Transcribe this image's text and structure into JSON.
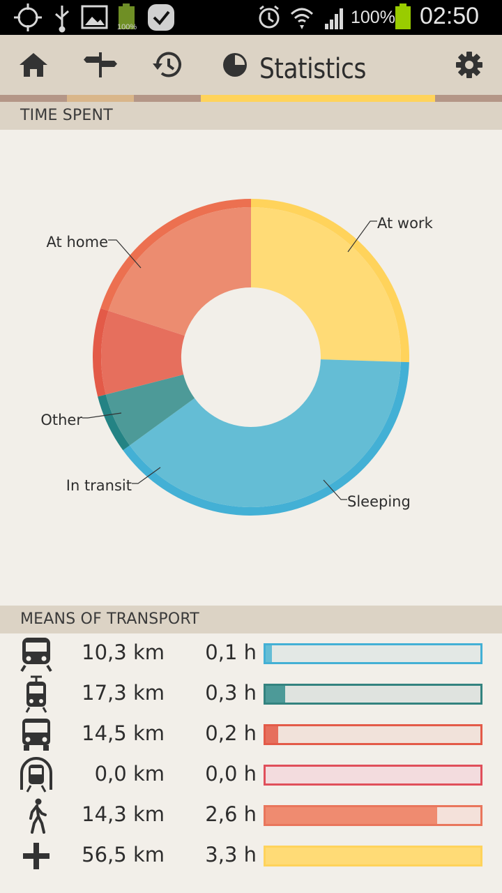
{
  "status_bar": {
    "battery_small_pct": "100%",
    "battery_pct": "100%",
    "time": "02:50",
    "icons": [
      "gps-icon",
      "usb-icon",
      "gallery-icon",
      "battery-small-icon",
      "check-icon",
      "alarm-icon",
      "wifi-icon",
      "signal-icon",
      "battery-icon"
    ]
  },
  "nav": {
    "title": "Statistics",
    "icons": [
      "home-icon",
      "signpost-icon",
      "history-icon",
      "statistics-pie-icon",
      "settings-gear-icon"
    ],
    "tab_colors": [
      "#b49687",
      "#d9b68a",
      "#b49687",
      "#ffd35b",
      "#b49687"
    ]
  },
  "time_spent": {
    "header": "TIME SPENT",
    "chart_data": {
      "type": "pie",
      "variant": "donut",
      "labels": [
        "At work",
        "Sleeping",
        "In transit",
        "Other",
        "At home"
      ],
      "values": [
        25.5,
        39.5,
        6.0,
        9.0,
        20.0
      ],
      "unit": "% of time (estimated)",
      "colors": [
        "#ffdb76",
        "#64bdd5",
        "#4d9a98",
        "#e66f5d",
        "#ec8c70"
      ],
      "rim_colors": [
        "#ffd35b",
        "#43b0d5",
        "#248384",
        "#e35a48",
        "#ec7050"
      ]
    }
  },
  "transport": {
    "header": "MEANS OF TRANSPORT",
    "rows": [
      {
        "icon": "train-icon",
        "distance": "10,3 km",
        "time": "0,1 h",
        "fraction": 0.03,
        "border": "#43b0d5",
        "fill": "#64bdd5",
        "track": "#e3e8e5"
      },
      {
        "icon": "tram-icon",
        "distance": "17,3 km",
        "time": "0,3 h",
        "fraction": 0.09,
        "border": "#33837f",
        "fill": "#4d9a98",
        "track": "#dfe3df"
      },
      {
        "icon": "bus-icon",
        "distance": "14,5 km",
        "time": "0,2 h",
        "fraction": 0.06,
        "border": "#e35a48",
        "fill": "#e66f5d",
        "track": "#f1e2da"
      },
      {
        "icon": "metro-icon",
        "distance": "0,0 km",
        "time": "0,0 h",
        "fraction": 0.0,
        "border": "#e04f5a",
        "fill": "#ea6a74",
        "track": "#f3dcde"
      },
      {
        "icon": "walk-icon",
        "distance": "14,3 km",
        "time": "2,6 h",
        "fraction": 0.8,
        "border": "#e9765c",
        "fill": "#ef8b70",
        "track": "#f4e1da"
      },
      {
        "icon": "other-plus-icon",
        "distance": "56,5 km",
        "time": "3,3 h",
        "fraction": 1.0,
        "border": "#ffd35b",
        "fill": "#ffdb76",
        "track": "#f8ecc8"
      }
    ]
  }
}
